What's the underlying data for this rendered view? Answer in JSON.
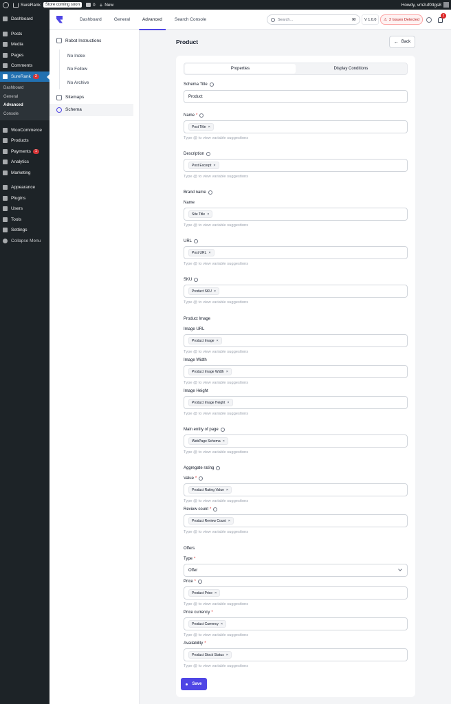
{
  "admin_bar": {
    "site_name": "SureRank",
    "store_badge": "Store coming soon",
    "comments_count": "0",
    "new_label": "New",
    "howdy": "Howdy, vm2uf0ttgs8"
  },
  "sidebar": {
    "items_top": [
      {
        "label": "Dashboard",
        "icon": "dashboard-icon"
      }
    ],
    "items_group1": [
      {
        "label": "Posts",
        "icon": "pin-icon"
      },
      {
        "label": "Media",
        "icon": "media-icon"
      },
      {
        "label": "Pages",
        "icon": "pages-icon"
      },
      {
        "label": "Comments",
        "icon": "comments-icon"
      }
    ],
    "surerank": {
      "label": "SureRank",
      "count": "2"
    },
    "submenu": [
      "Dashboard",
      "General",
      "Advanced",
      "Console"
    ],
    "items_group2": [
      {
        "label": "WooCommerce",
        "icon": "woocommerce-icon"
      },
      {
        "label": "Products",
        "icon": "products-icon"
      },
      {
        "label": "Payments",
        "icon": "payments-icon",
        "count": "1"
      },
      {
        "label": "Analytics",
        "icon": "analytics-icon"
      },
      {
        "label": "Marketing",
        "icon": "marketing-icon"
      }
    ],
    "items_group3": [
      {
        "label": "Appearance",
        "icon": "appearance-icon"
      },
      {
        "label": "Plugins",
        "icon": "plugins-icon"
      },
      {
        "label": "Users",
        "icon": "users-icon"
      },
      {
        "label": "Tools",
        "icon": "tools-icon"
      },
      {
        "label": "Settings",
        "icon": "settings-icon"
      }
    ],
    "collapse_label": "Collapse Menu"
  },
  "topnav": {
    "tabs": [
      "Dashboard",
      "General",
      "Advanced",
      "Search Console"
    ],
    "active_tab": "Advanced",
    "search_placeholder": "Search...",
    "search_shortcut": "⌘/",
    "version": "V 1.0.0",
    "issues": "2 Issues Detected",
    "notification_count": "2",
    "accent_color": "#4f46e5"
  },
  "left_panel": {
    "robot_instructions": "Robot Instructions",
    "robot_items": [
      "No Index",
      "No Follow",
      "No Archive"
    ],
    "sitemaps": "Sitemaps",
    "schema": "Schema"
  },
  "main": {
    "title": "Product",
    "back_label": "Back",
    "segment_tabs": [
      "Properties",
      "Display Conditions"
    ],
    "schema_title_label": "Schema Title",
    "schema_title_value": "Product",
    "hint": "Type @ to view variable suggestions",
    "fields": {
      "name": {
        "label": "Name",
        "chip": "Post Title"
      },
      "description": {
        "label": "Description",
        "chip": "Post Excerpt"
      },
      "brand_heading": "Brand name",
      "brand_name": {
        "label": "Name",
        "chip": "Site Title"
      },
      "url": {
        "label": "URL",
        "chip": "Post URL"
      },
      "sku": {
        "label": "SKU",
        "chip": "Product SKU"
      },
      "image_heading": "Product Image",
      "image_url": {
        "label": "Image URL",
        "chip": "Product Image"
      },
      "image_width": {
        "label": "Image Width",
        "chip": "Product Image Width"
      },
      "image_height": {
        "label": "Image Height",
        "chip": "Product Image Height"
      },
      "main_entity": {
        "label": "Main entity of page",
        "chip": "WebPage Schema"
      },
      "rating_heading": "Aggregate rating",
      "rating_value": {
        "label": "Value",
        "chip": "Product Rating Value"
      },
      "review_count": {
        "label": "Review count",
        "chip": "Product Review Count"
      },
      "offers_heading": "Offers",
      "offer_type": {
        "label": "Type",
        "value": "Offer"
      },
      "price": {
        "label": "Price",
        "chip": "Product Price"
      },
      "price_currency": {
        "label": "Price currency",
        "chip": "Product Currency"
      },
      "availability": {
        "label": "Availability",
        "chip": "Product Stock Status"
      }
    },
    "chip_close": "×",
    "required_mark": "*",
    "save_label": "Save"
  }
}
